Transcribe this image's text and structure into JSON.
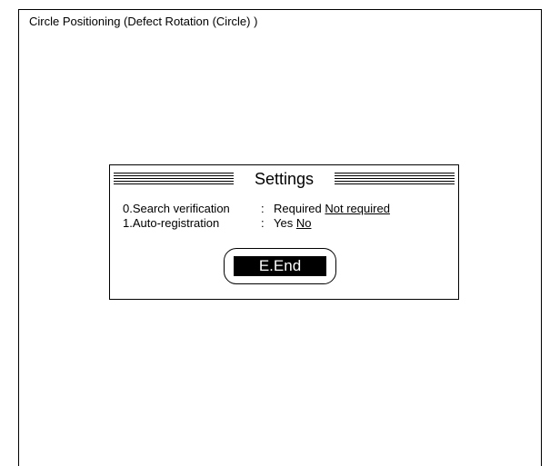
{
  "screen": {
    "title": "Circle Positioning (Defect Rotation (Circle) )"
  },
  "dialog": {
    "title": "Settings",
    "settings": [
      {
        "label": "0.Search verification",
        "separator": ":",
        "options": [
          "Required",
          "Not required"
        ],
        "selected": "Not required"
      },
      {
        "label": "1.Auto-registration",
        "separator": ":",
        "options": [
          "Yes",
          "No"
        ],
        "selected": "No"
      }
    ],
    "end_button_label": "E.End"
  }
}
